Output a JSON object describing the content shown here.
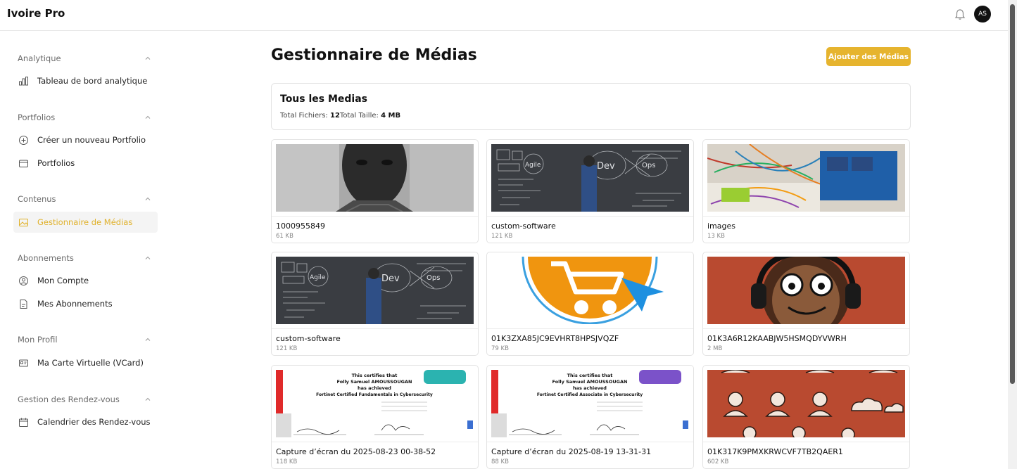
{
  "app": {
    "brand": "Ivoire Pro",
    "avatar_initials": "AS"
  },
  "sidebar": {
    "sections": [
      {
        "title": "Analytique",
        "items": [
          {
            "label": "Tableau de bord analytique",
            "icon": "bar-chart-icon"
          }
        ]
      },
      {
        "title": "Portfolios",
        "items": [
          {
            "label": "Créer un nouveau Portfolio",
            "icon": "plus-circle-icon"
          },
          {
            "label": "Portfolios",
            "icon": "folder-icon"
          }
        ]
      },
      {
        "title": "Contenus",
        "items": [
          {
            "label": "Gestionnaire de Médias",
            "icon": "image-icon",
            "active": true
          }
        ]
      },
      {
        "title": "Abonnements",
        "items": [
          {
            "label": "Mon Compte",
            "icon": "user-circle-icon"
          },
          {
            "label": "Mes Abonnements",
            "icon": "document-icon"
          }
        ]
      },
      {
        "title": "Mon Profil",
        "items": [
          {
            "label": "Ma Carte Virtuelle (VCard)",
            "icon": "id-card-icon"
          }
        ]
      },
      {
        "title": "Gestion des Rendez-vous",
        "items": [
          {
            "label": "Calendrier des Rendez-vous",
            "icon": "calendar-icon"
          }
        ]
      }
    ]
  },
  "main": {
    "title": "Gestionnaire de Médias",
    "add_button": "Ajouter des Médias",
    "summary": {
      "title": "Tous les Medias",
      "files_label": "Total Fichiers: ",
      "files_value": "12",
      "size_label": "Total Taille: ",
      "size_value": "4 MB"
    },
    "media": [
      {
        "name": "1000955849",
        "size": "61 KB",
        "thumb": "portrait-photo"
      },
      {
        "name": "custom-software",
        "size": "121 KB",
        "thumb": "devops-blackboard"
      },
      {
        "name": "images",
        "size": "13 KB",
        "thumb": "electronics-board"
      },
      {
        "name": "custom-software",
        "size": "121 KB",
        "thumb": "devops-blackboard"
      },
      {
        "name": "01K3ZXA85JC9EVHRT8HPSJVQZF",
        "size": "79 KB",
        "thumb": "cart-logo"
      },
      {
        "name": "01K3A6R12KAABJW5HSMQDYVWRH",
        "size": "2 MB",
        "thumb": "cartoon-headphones"
      },
      {
        "name": "Capture d’écran du 2025-08-23 00-38-52",
        "size": "118 KB",
        "thumb": "certificate-fundamentals"
      },
      {
        "name": "Capture d’écran du 2025-08-19 13-31-31",
        "size": "88 KB",
        "thumb": "certificate-associate"
      },
      {
        "name": "01K317K9PMXKRWCVF7TB2QAER1",
        "size": "602 KB",
        "thumb": "people-icons-pattern"
      }
    ],
    "thumbs_text": {
      "devops_left": "Agile",
      "devops_right": "Dev",
      "devops_ops": "Ops",
      "cert_line1": "This certifies that",
      "cert_line2": "Folly Samuel AMOUSSOUGAN",
      "cert_line3": "has achieved",
      "cert_fundamentals": "Fortinet Certified Fundamentals in Cybersecurity",
      "cert_associate": "Fortinet Certified Associate in Cybersecurity"
    }
  }
}
